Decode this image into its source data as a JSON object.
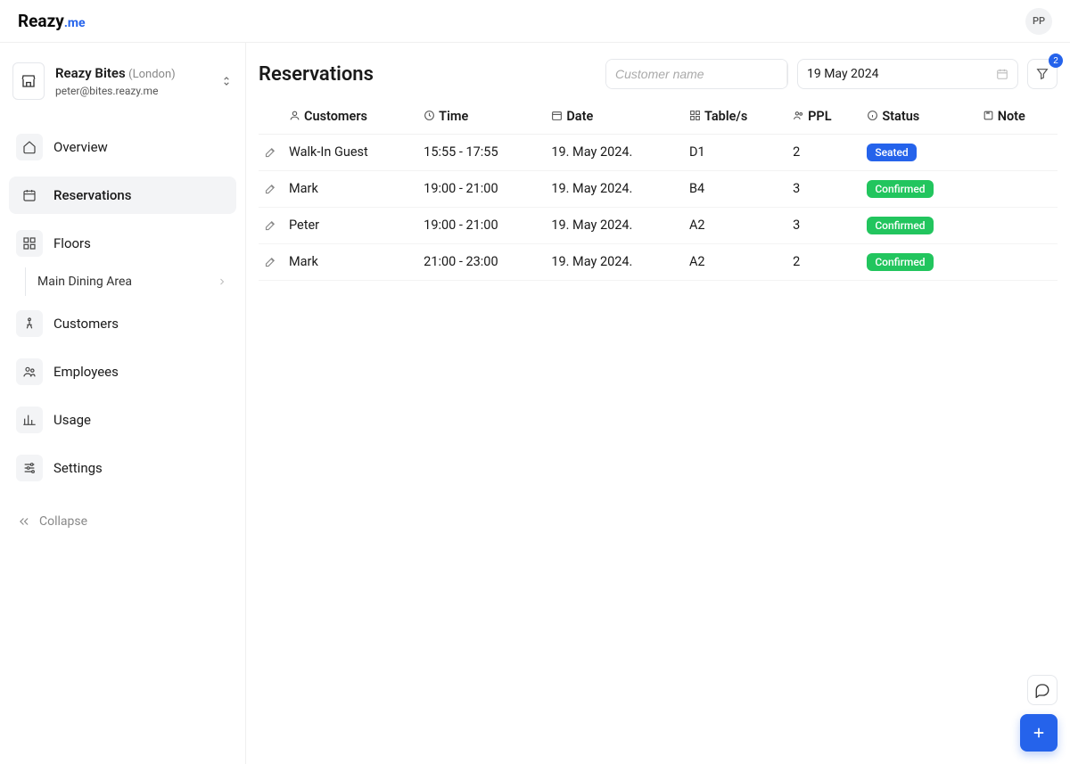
{
  "brand": {
    "main": "Reazy",
    "suffix": ".me"
  },
  "avatar": "PP",
  "org": {
    "name": "Reazy Bites",
    "location": "(London)",
    "email": "peter@bites.reazy.me"
  },
  "nav": {
    "overview": "Overview",
    "reservations": "Reservations",
    "floors": "Floors",
    "floors_sub": "Main Dining Area",
    "customers": "Customers",
    "employees": "Employees",
    "usage": "Usage",
    "settings": "Settings",
    "collapse": "Collapse"
  },
  "page": {
    "title": "Reservations",
    "search_placeholder": "Customer name",
    "date_value": "19 May 2024",
    "filter_count": "2"
  },
  "table": {
    "headers": {
      "customers": "Customers",
      "time": "Time",
      "date": "Date",
      "tables": "Table/s",
      "ppl": "PPL",
      "status": "Status",
      "note": "Note"
    },
    "rows": [
      {
        "customer": "Walk-In Guest",
        "time": "15:55 - 17:55",
        "date": "19. May 2024.",
        "table": "D1",
        "ppl": "2",
        "status": "Seated",
        "status_color": "blue"
      },
      {
        "customer": "Mark",
        "time": "19:00 - 21:00",
        "date": "19. May 2024.",
        "table": "B4",
        "ppl": "3",
        "status": "Confirmed",
        "status_color": "green"
      },
      {
        "customer": "Peter",
        "time": "19:00 - 21:00",
        "date": "19. May 2024.",
        "table": "A2",
        "ppl": "3",
        "status": "Confirmed",
        "status_color": "green"
      },
      {
        "customer": "Mark",
        "time": "21:00 - 23:00",
        "date": "19. May 2024.",
        "table": "A2",
        "ppl": "2",
        "status": "Confirmed",
        "status_color": "green"
      }
    ]
  }
}
